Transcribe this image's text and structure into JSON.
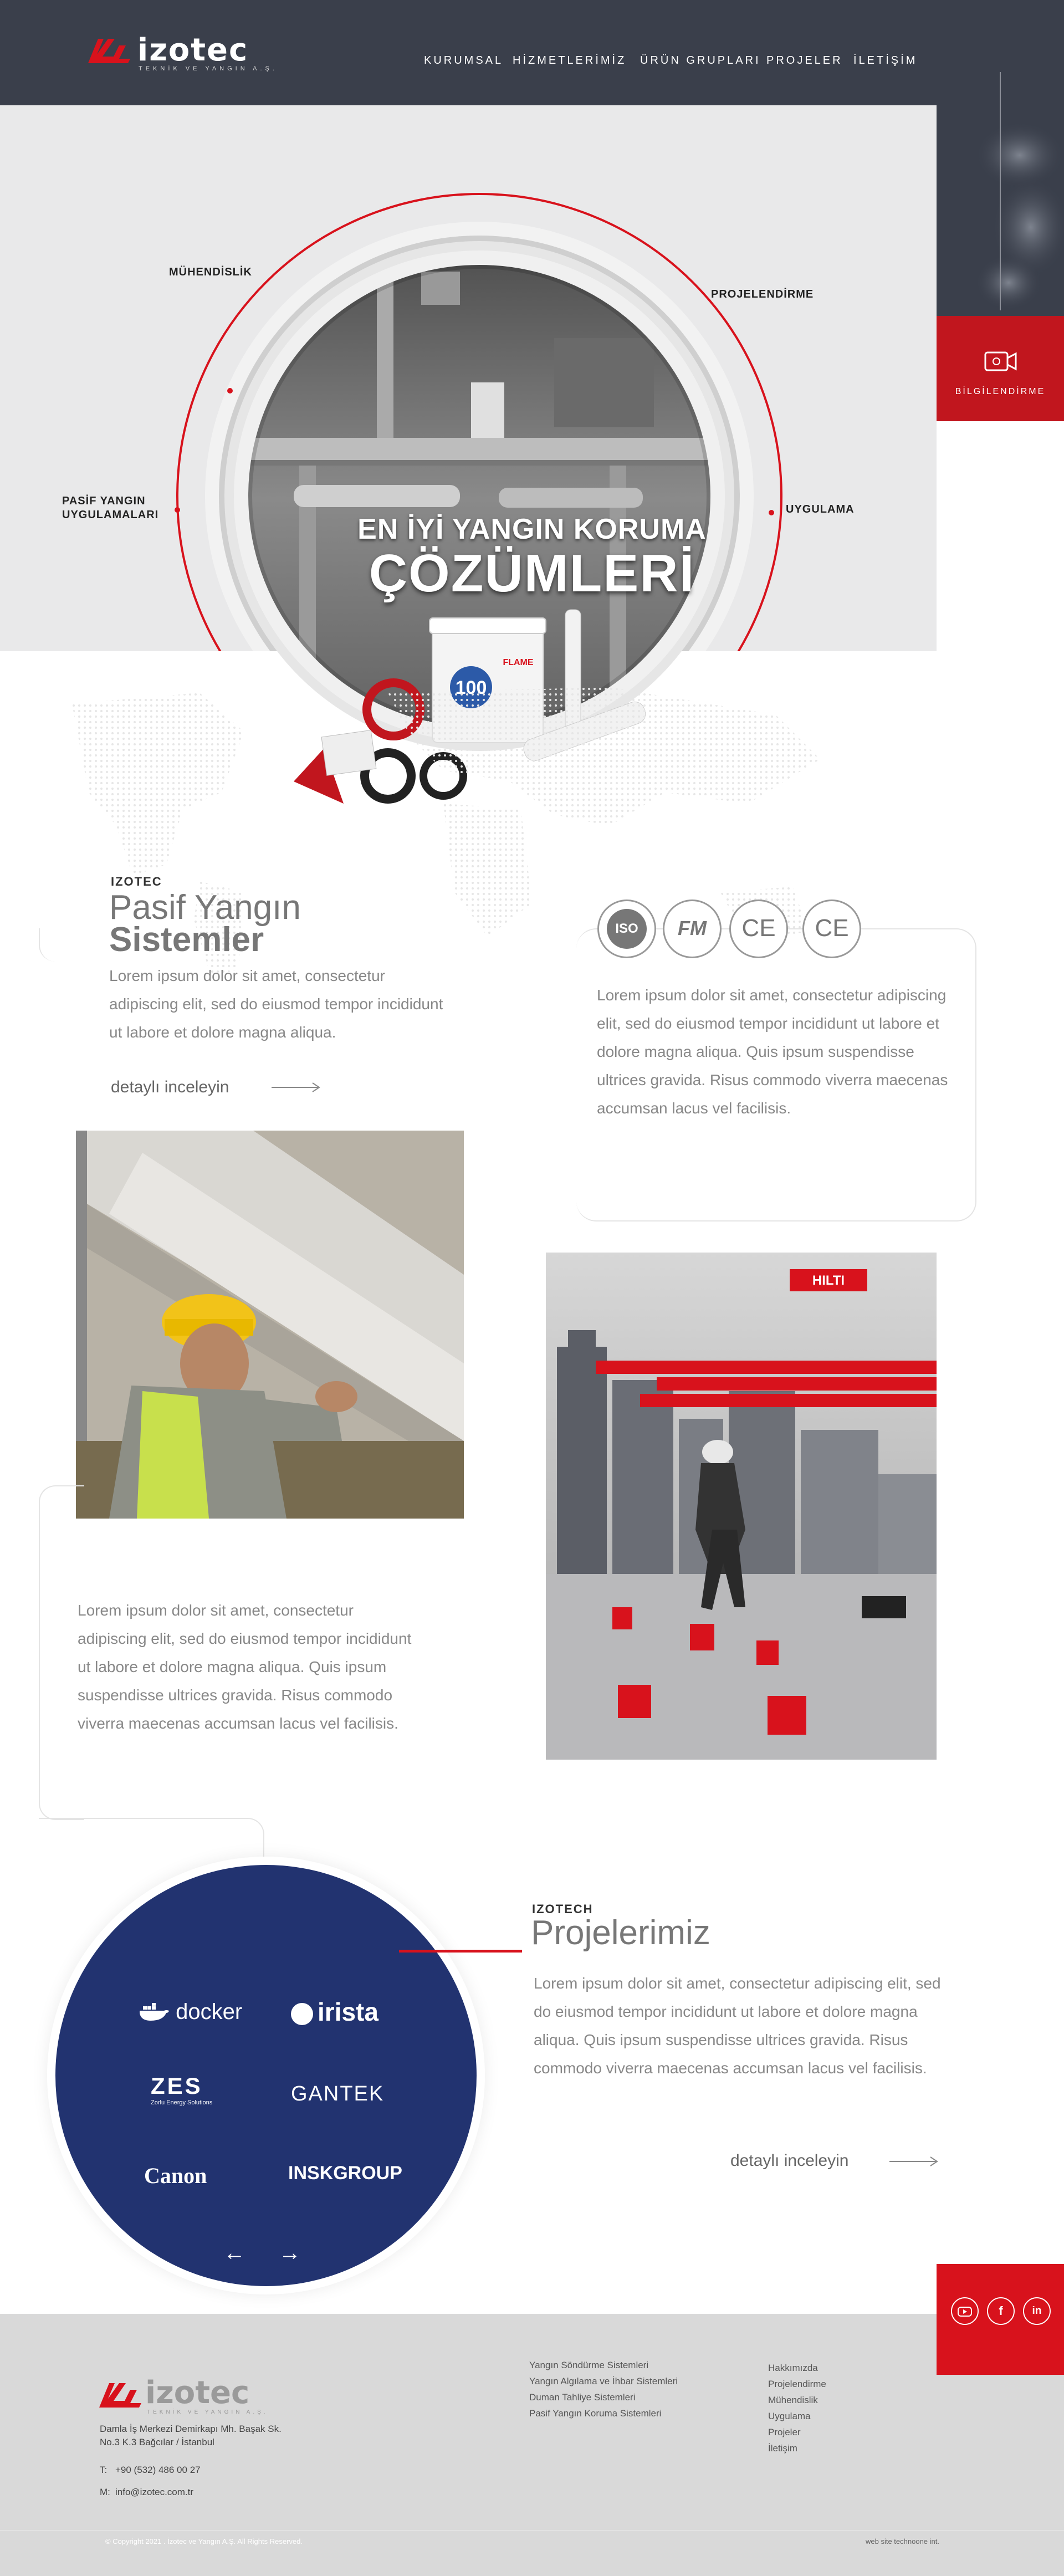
{
  "header": {
    "logo_text": "izotec",
    "logo_subtitle": "TEKNİK VE YANGIN A.Ş.",
    "nav": [
      "KURUMSAL",
      "HİZMETLERİMİZ",
      "ÜRÜN GRUPLARI",
      "PROJELER",
      "İLETİŞİM"
    ]
  },
  "side": {
    "info_label": "BİLGİLENDİRME"
  },
  "hero": {
    "labels": [
      "MÜHENDİSLİK",
      "PROJELENDİRME",
      "PASİF YANGIN",
      "UYGULAMALARI",
      "UYGULAMA"
    ],
    "title_line1": "EN İYİ YANGIN KORUMA",
    "title_line2": "ÇÖZÜMLERİ",
    "product_labels": [
      "100",
      "FLAME"
    ]
  },
  "section1": {
    "small": "IZOTEC",
    "title_light": "Pasif Yangın",
    "title_bold": "Sistemler",
    "text": "Lorem ipsum dolor sit amet, consectetur adipiscing elit, sed do eiusmod tempor incididunt ut labore et dolore magna aliqua.",
    "more": "detaylı inceleyin"
  },
  "certs": {
    "badges": [
      "ISO",
      "FM",
      "CE",
      "CE"
    ],
    "text": "Lorem ipsum dolor sit amet, consectetur adipiscing elit, sed do eiusmod tempor incididunt ut labore et dolore magna aliqua. Quis ipsum suspendisse ultrices gravida. Risus commodo viverra maecenas accumsan lacus vel facilisis."
  },
  "section2": {
    "text": "Lorem ipsum dolor sit amet, consectetur adipiscing elit, sed do eiusmod tempor incididunt ut labore et dolore magna aliqua. Quis ipsum suspendisse ultrices gravida. Risus commodo viverra maecenas accumsan lacus vel facilisis.",
    "hilti_logo": "HILTI"
  },
  "projects": {
    "small": "IZOTECH",
    "title": "Projelerimiz",
    "text": "Lorem ipsum dolor sit amet, consectetur adipiscing elit, sed do eiusmod tempor incididunt ut labore et dolore magna aliqua. Quis ipsum suspendisse ultrices gravida. Risus commodo viverra maecenas accumsan lacus vel facilisis.",
    "more": "detaylı inceleyin",
    "brands": [
      "docker",
      "irista",
      "ZES",
      "Zorlu Energy Solutions",
      "GANTEK",
      "Canon",
      "INSKGROUP"
    ],
    "prev": "←",
    "next": "→"
  },
  "social": {
    "icons": [
      "youtube-icon",
      "facebook-icon",
      "linkedin-icon"
    ]
  },
  "footer": {
    "logo_text": "izotec",
    "logo_subtitle": "TEKNİK VE YANGIN A.Ş.",
    "address_line1": "Damla İş Merkezi Demirkapı Mh. Başak Sk.",
    "address_line2": "No.3 K.3 Bağcılar / İstanbul",
    "phone_label": "T:",
    "phone": "+90 (532) 486 00 27",
    "mail_label": "M:",
    "email": "info@izotec.com.tr",
    "services": [
      "Yangın Söndürme Sistemleri",
      "Yangın Algılama ve İhbar Sistemleri",
      "Duman Tahliye Sistemleri",
      "Pasif Yangın Koruma Sistemleri"
    ],
    "links": [
      "Hakkımızda",
      "Projelendirme",
      "Mühendislik",
      "Uygulama",
      "Projeler",
      "İletişim"
    ],
    "copyright": "© Copyright 2021 . İzotec ve Yangın A.Ş. All Rights Reserved.",
    "credit": "web site  technoone int."
  },
  "colors": {
    "header_bg": "#3a3f4b",
    "accent_red": "#c1161e",
    "projects_blue": "#223370",
    "footer_bg": "#d9d9d9"
  }
}
